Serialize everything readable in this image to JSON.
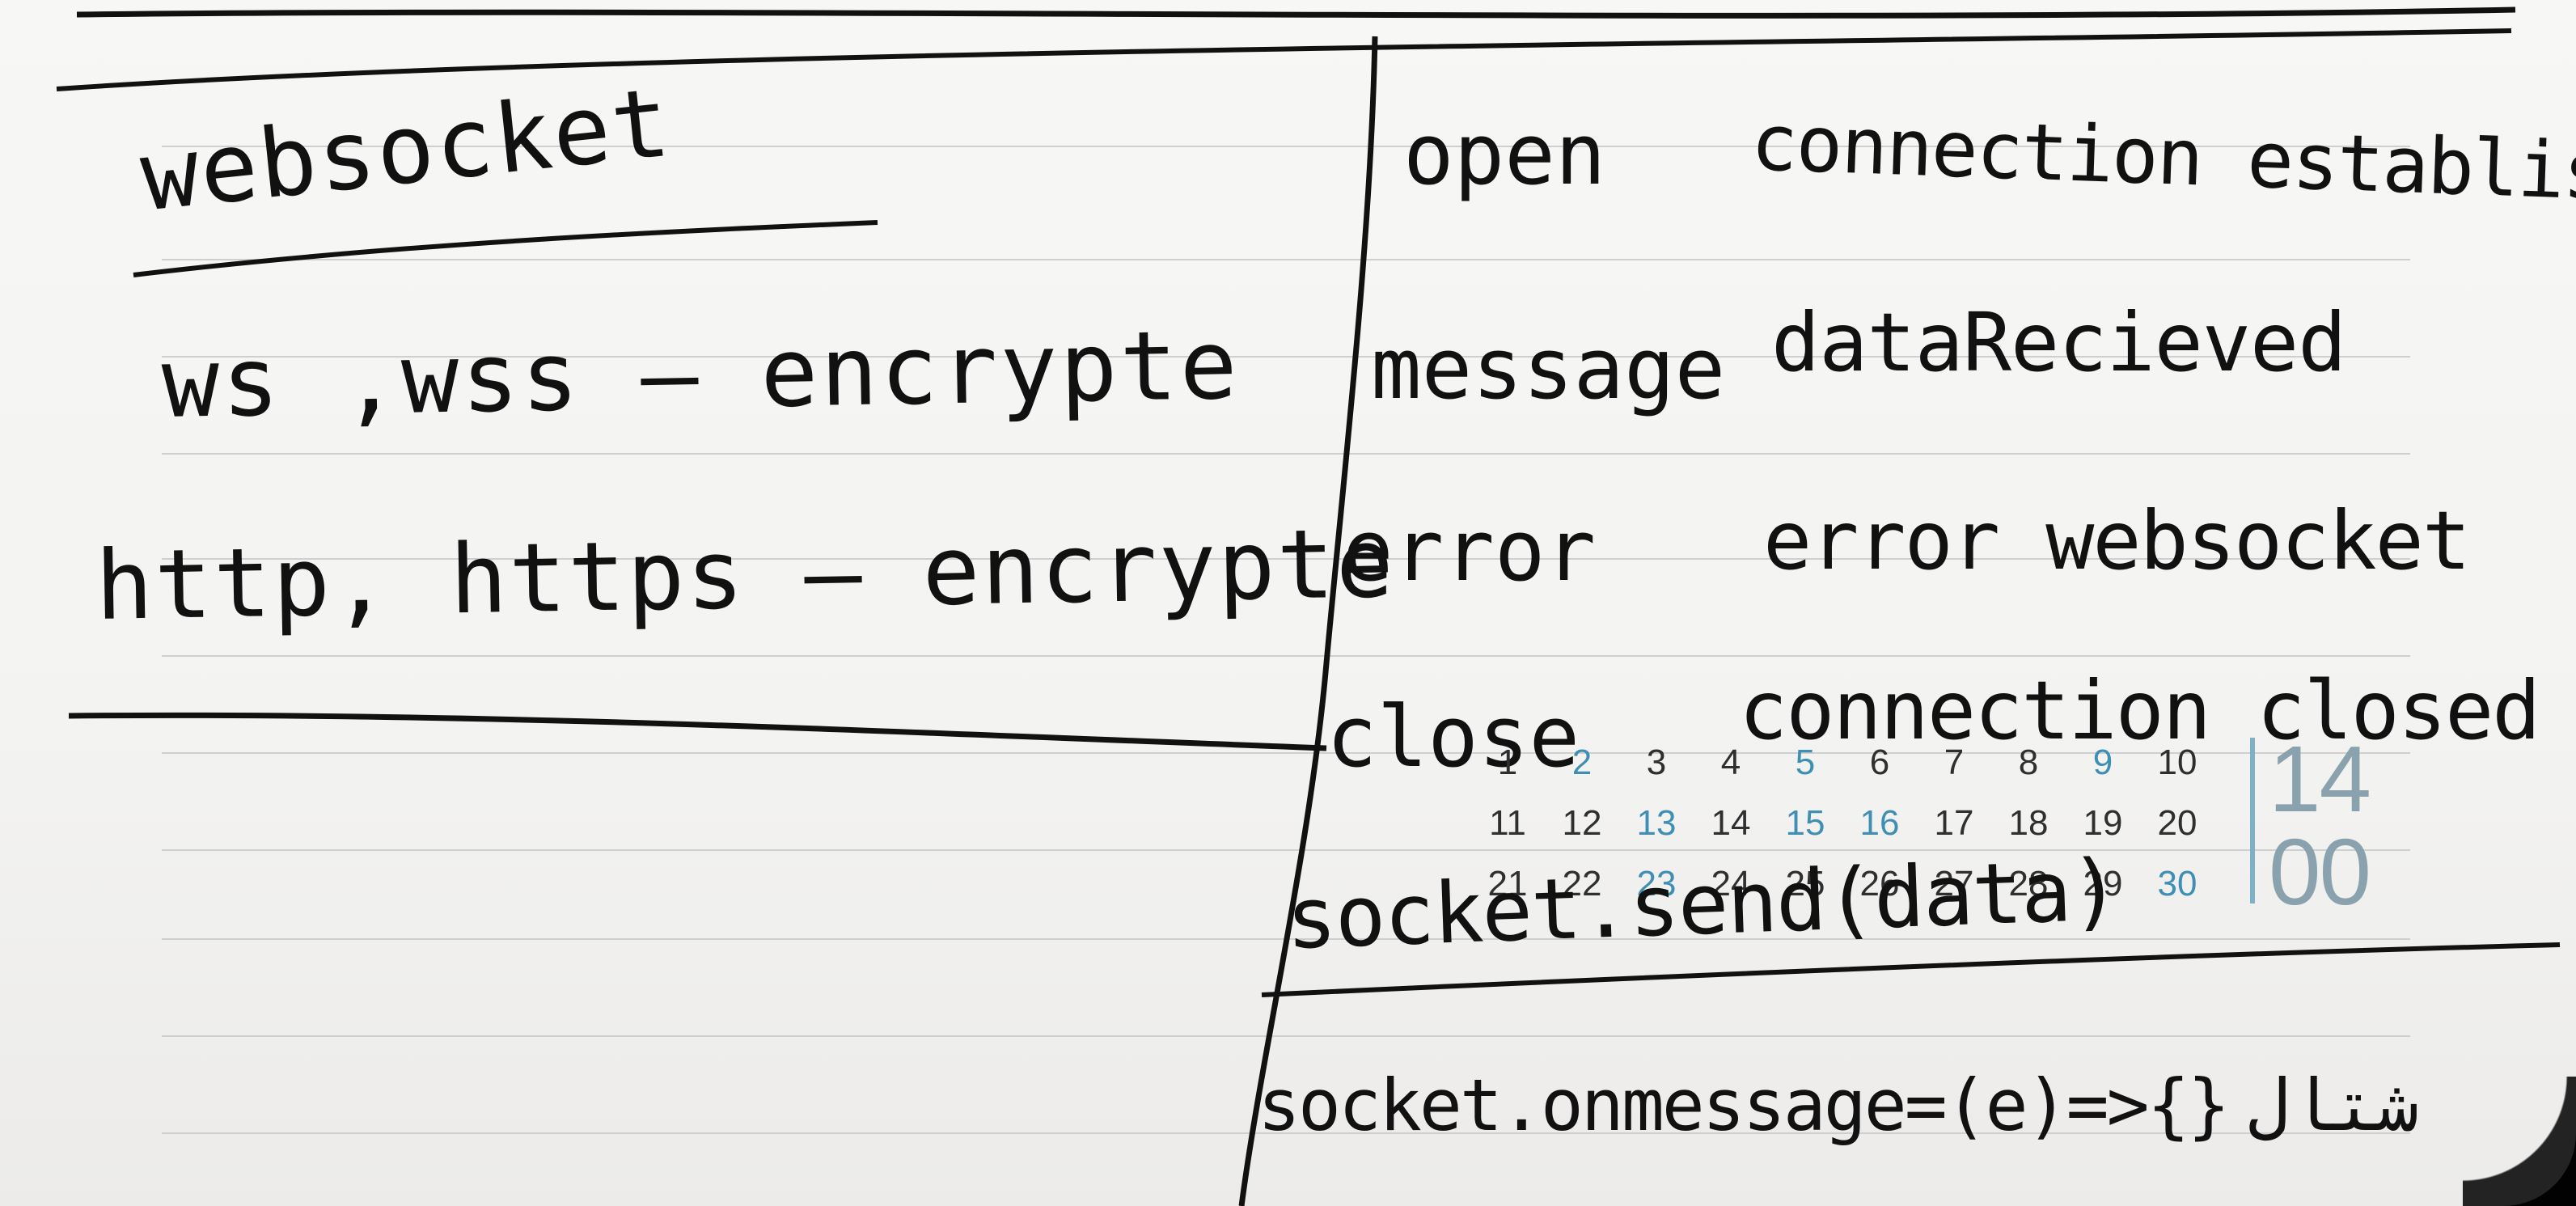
{
  "note": {
    "title": "websocket",
    "left_lines": [
      "ws ,wss — encrypte",
      "http, https — encrypte"
    ],
    "events": [
      {
        "name": "open",
        "desc": "connection established"
      },
      {
        "name": "message",
        "desc": "dataRecieved"
      },
      {
        "name": "error",
        "desc": "error websocket"
      },
      {
        "name": "close",
        "desc": "connection closed"
      }
    ],
    "code_send": "socket.send(data)",
    "code_onmessage": "socket.onmessage=(e)=>{}",
    "code_onmessage_suffix": "شتال"
  },
  "calendar": {
    "rows": [
      [
        "1",
        "2",
        "3",
        "4",
        "5",
        "6",
        "7",
        "8",
        "9",
        "10"
      ],
      [
        "11",
        "12",
        "13",
        "14",
        "15",
        "16",
        "17",
        "18",
        "19",
        "20"
      ],
      [
        "21",
        "22",
        "23",
        "24",
        "25",
        "26",
        "27",
        "28",
        "29",
        "30"
      ]
    ],
    "highlight_color": "#3f8fb4",
    "hour": "14",
    "minute": "00"
  },
  "colors": {
    "paper": "#f5f5f3",
    "ink": "#111111",
    "rule_line": "#cfcfcf",
    "background": "#0d0d0d"
  }
}
